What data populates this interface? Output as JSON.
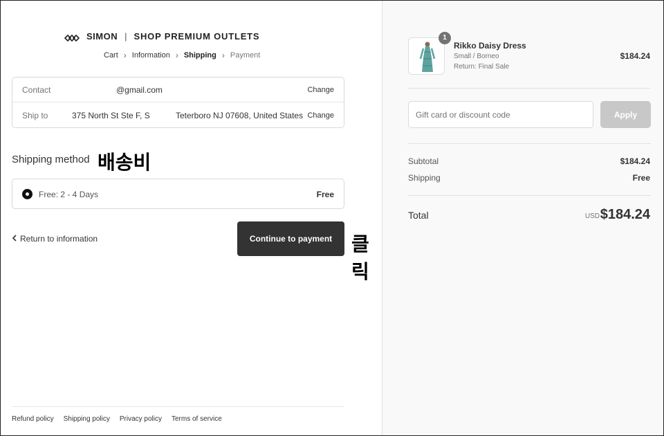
{
  "brand": {
    "logo_text": "SIMON",
    "logo_mark": "simon-logo-icon",
    "separator": "|",
    "store_name": "SHOP PREMIUM OUTLETS"
  },
  "breadcrumb": {
    "items": [
      {
        "label": "Cart",
        "state": "done"
      },
      {
        "label": "Information",
        "state": "done"
      },
      {
        "label": "Shipping",
        "state": "current"
      },
      {
        "label": "Payment",
        "state": "upcoming"
      }
    ]
  },
  "review": {
    "contact_label": "Contact",
    "contact_value": "@gmail.com",
    "ship_to_label": "Ship to",
    "ship_to_address": "375 North St Ste F, S",
    "ship_to_city": "Teterboro NJ 07608, United States",
    "change_label": "Change"
  },
  "shipping": {
    "title": "Shipping method",
    "option_label": "Free: 2 - 4 Days",
    "option_price": "Free"
  },
  "annotations": {
    "shipping_cost": "배송비",
    "click": "클릭"
  },
  "actions": {
    "return_label": "Return to information",
    "continue_label": "Continue to payment"
  },
  "footer": {
    "links": [
      "Refund policy",
      "Shipping policy",
      "Privacy policy",
      "Terms of service"
    ]
  },
  "order": {
    "item": {
      "quantity": "1",
      "name": "Rikko Daisy Dress",
      "variant": "Small / Borneo",
      "return_policy": "Return: Final Sale",
      "price": "$184.24"
    },
    "discount_placeholder": "Gift card or discount code",
    "apply_label": "Apply",
    "subtotal_label": "Subtotal",
    "subtotal_value": "$184.24",
    "shipping_label": "Shipping",
    "shipping_value": "Free",
    "total_label": "Total",
    "currency": "USD",
    "total_value": "$184.24"
  },
  "colors": {
    "primary_button": "#333333",
    "disabled_button": "#c8c8c8",
    "sidebar_bg": "#f9f9f9"
  }
}
